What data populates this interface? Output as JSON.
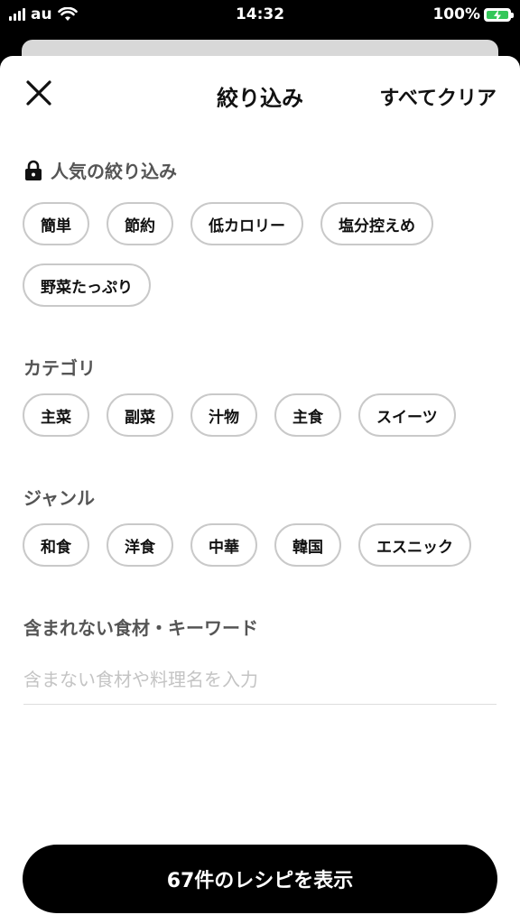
{
  "status_bar": {
    "carrier": "au",
    "time": "14:32",
    "battery": "100%"
  },
  "header": {
    "title": "絞り込み",
    "clear_label": "すべてクリア"
  },
  "popular": {
    "title": "人気の絞り込み",
    "chips": [
      "簡単",
      "節約",
      "低カロリー",
      "塩分控えめ",
      "野菜たっぷり"
    ]
  },
  "category": {
    "title": "カテゴリ",
    "chips": [
      "主菜",
      "副菜",
      "汁物",
      "主食",
      "スイーツ"
    ]
  },
  "genre": {
    "title": "ジャンル",
    "chips": [
      "和食",
      "洋食",
      "中華",
      "韓国",
      "エスニック"
    ]
  },
  "exclude": {
    "title": "含まれない食材・キーワード",
    "placeholder": "含まない食材や料理名を入力",
    "value": ""
  },
  "cta_label": "67件のレシピを表示"
}
